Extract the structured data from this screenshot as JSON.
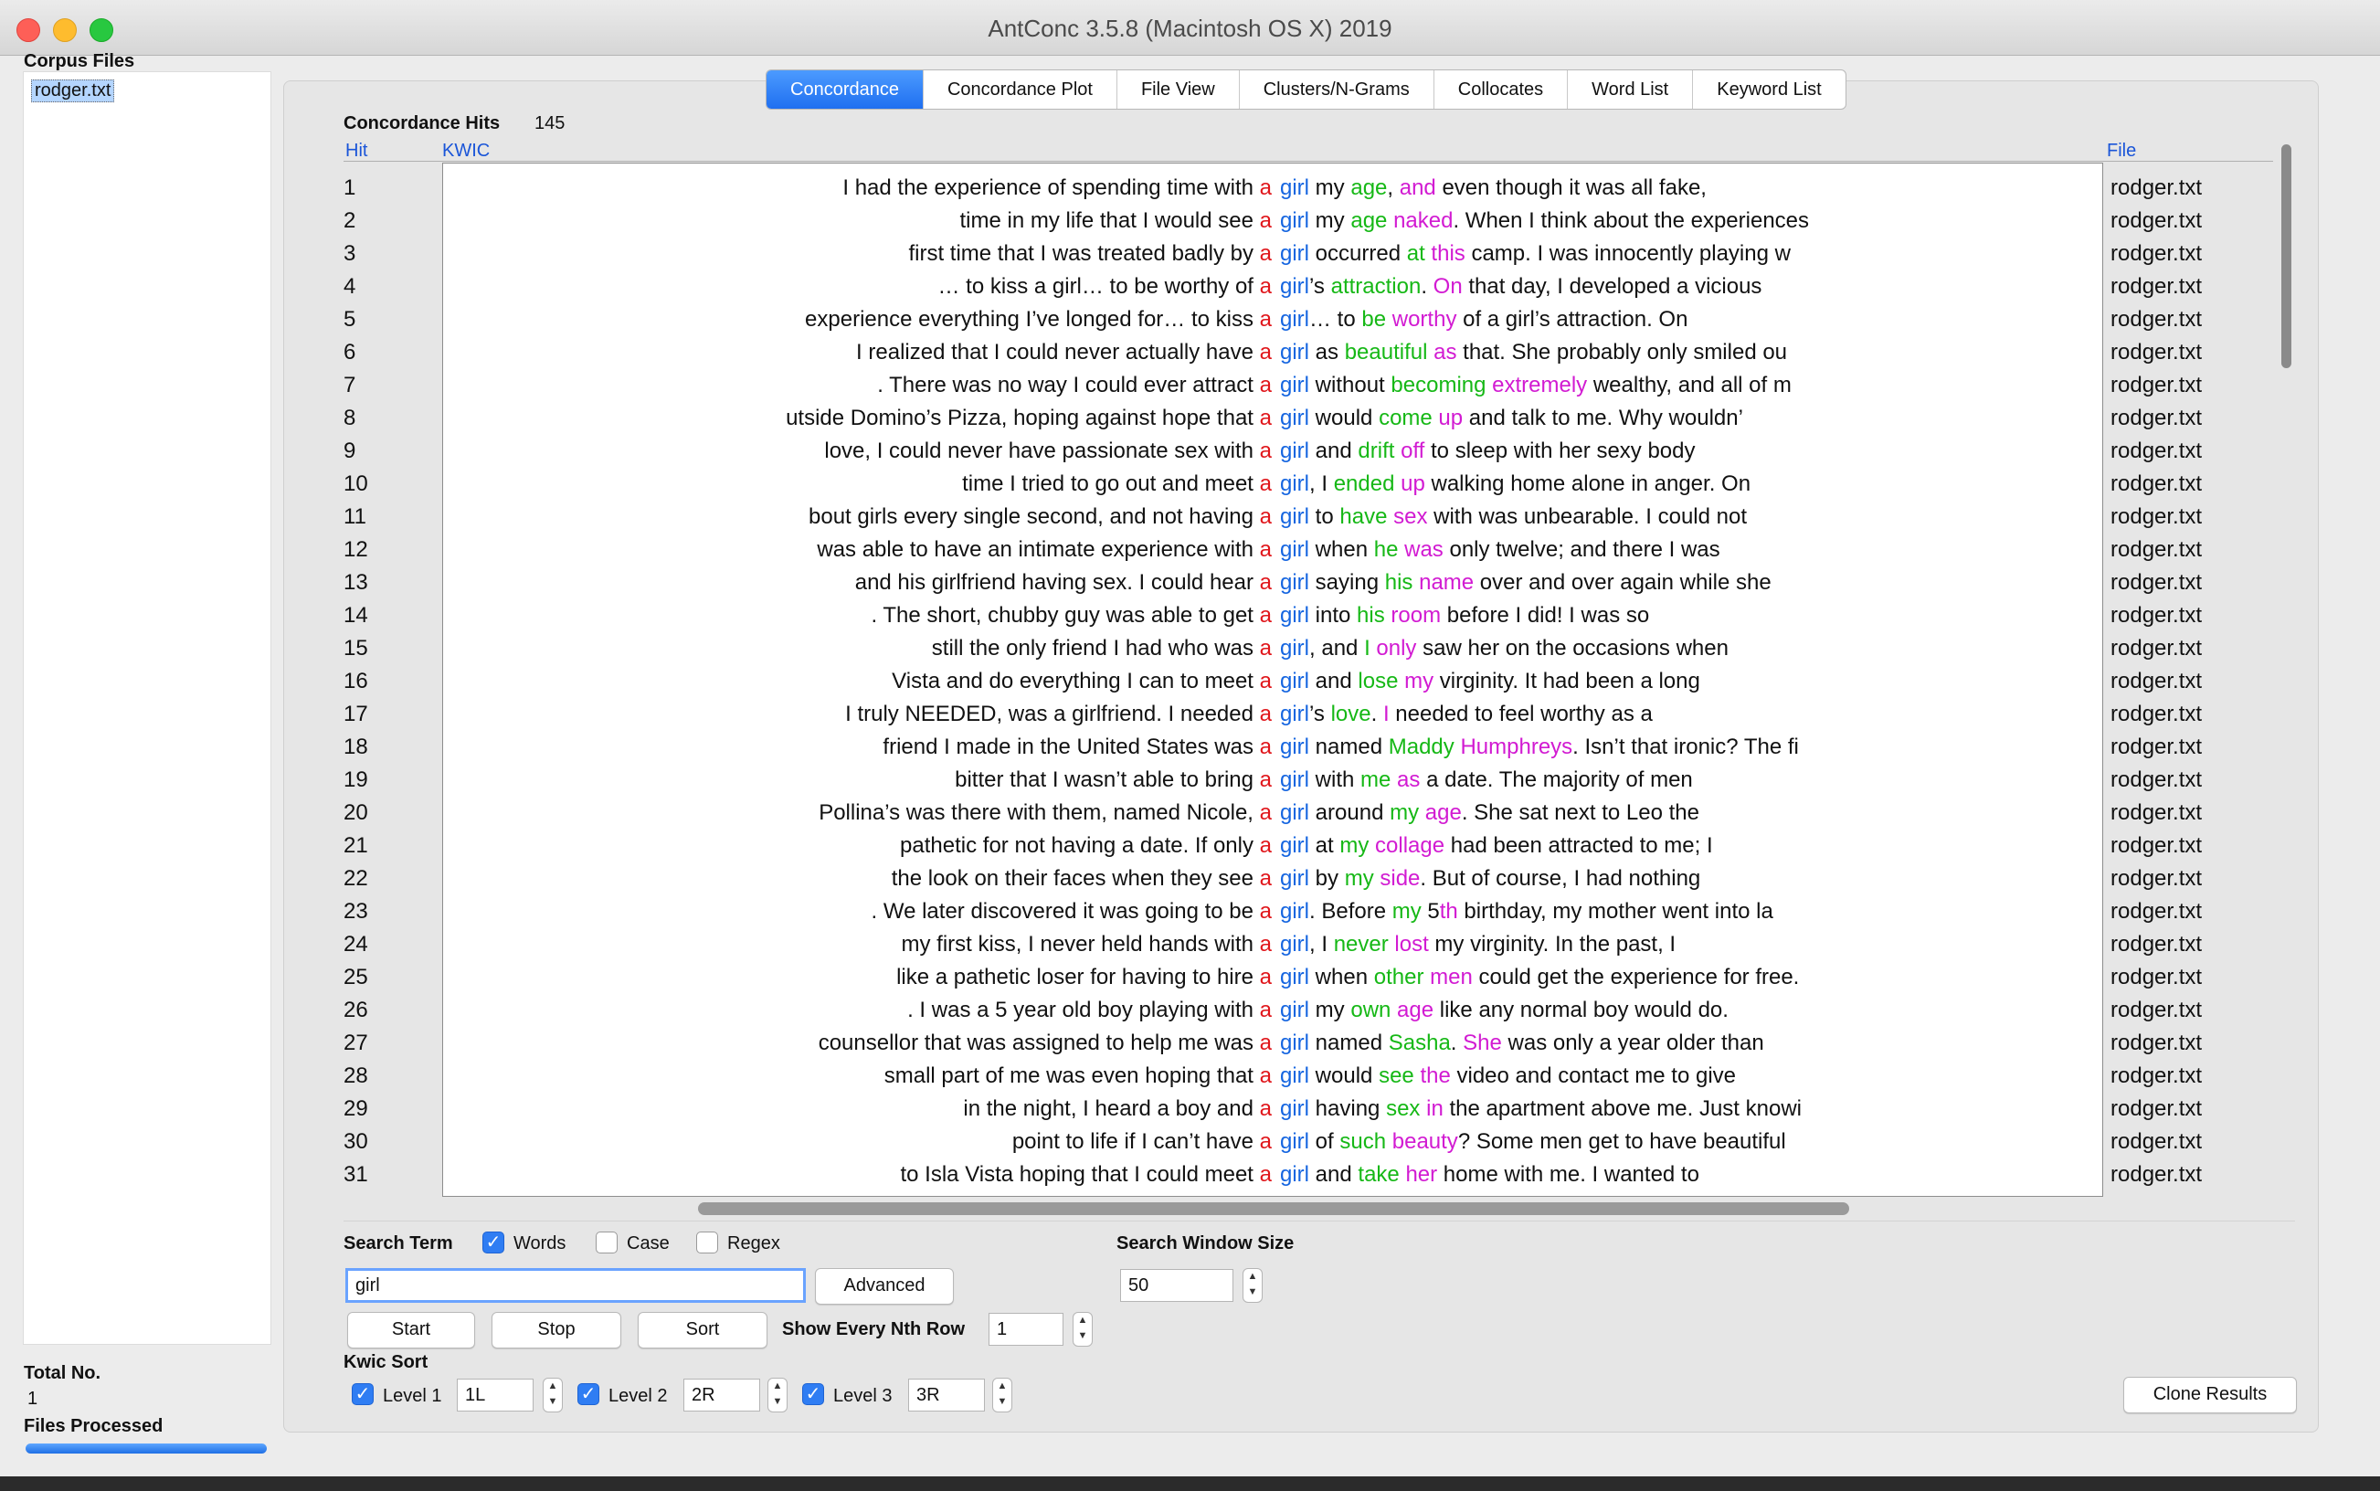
{
  "window": {
    "title": "AntConc 3.5.8 (Macintosh OS X) 2019"
  },
  "sidebar": {
    "corpus_files_label": "Corpus Files",
    "files": [
      "rodger.txt"
    ],
    "total_no_label": "Total No.",
    "total_no_value": "1",
    "files_processed_label": "Files Processed",
    "progress": 1.0
  },
  "tabs": [
    "Concordance",
    "Concordance Plot",
    "File View",
    "Clusters/N-Grams",
    "Collocates",
    "Word List",
    "Keyword List"
  ],
  "active_tab": "Concordance",
  "results": {
    "hits_label": "Concordance Hits",
    "hits_count": "145",
    "col_hit": "Hit",
    "col_kwic": "KWIC",
    "col_file": "File",
    "rows": [
      {
        "hit": "1",
        "left": "I had the experience of spending time with",
        "key": "girl",
        "right": [
          [
            "my ",
            ""
          ],
          [
            "age",
            ""
          ],
          [
            ", ",
            ""
          ],
          [
            "and",
            ""
          ],
          [
            "  even though it was all fake,",
            ""
          ]
        ],
        "file": "rodger.txt"
      },
      {
        "hit": "2",
        "left": "time in my life that I would see",
        "key": "girl",
        "right": [
          [
            "my ",
            ""
          ],
          [
            "age",
            ""
          ],
          [
            " ",
            ""
          ],
          [
            "naked",
            ""
          ],
          [
            ". When  I think about the experiences",
            ""
          ]
        ],
        "file": "rodger.txt"
      },
      {
        "hit": "3",
        "left": "first time that I was treated badly  by",
        "key": "girl",
        "right": [
          [
            "occurred ",
            ""
          ],
          [
            "at",
            ""
          ],
          [
            " ",
            ""
          ],
          [
            "this",
            ""
          ],
          [
            " camp. I was innocently playing w",
            ""
          ]
        ],
        "file": "rodger.txt"
      },
      {
        "hit": "4",
        "left": "… to kiss a girl… to be worthy of",
        "key": "girl",
        "right": [
          [
            "’s ",
            ""
          ],
          [
            "attraction",
            ""
          ],
          [
            ". ",
            ""
          ],
          [
            "On",
            ""
          ],
          [
            " that day, I developed a vicious",
            ""
          ]
        ],
        "file": "rodger.txt"
      },
      {
        "hit": "5",
        "left": "experience everything I’ve longed for… to kiss",
        "key": "girl",
        "right": [
          [
            "… to ",
            ""
          ],
          [
            "be",
            ""
          ],
          [
            " ",
            ""
          ],
          [
            "worthy",
            ""
          ],
          [
            " of a  girl’s attraction. On",
            ""
          ]
        ],
        "file": "rodger.txt"
      },
      {
        "hit": "6",
        "left": "I  realized that I could never actually have",
        "key": "girl",
        "right": [
          [
            "as ",
            ""
          ],
          [
            "beautiful",
            ""
          ],
          [
            " ",
            ""
          ],
          [
            "as",
            ""
          ],
          [
            " that. She probably only smiled ou",
            ""
          ]
        ],
        "file": "rodger.txt"
      },
      {
        "hit": "7",
        "left": ". There was no way I could ever attract",
        "key": "girl",
        "right": [
          [
            "without  ",
            ""
          ],
          [
            "becoming",
            ""
          ],
          [
            " ",
            ""
          ],
          [
            "extremely",
            ""
          ],
          [
            " wealthy, and all of m",
            ""
          ]
        ],
        "file": "rodger.txt"
      },
      {
        "hit": "8",
        "left": "utside Domino’s Pizza, hoping against hope that",
        "key": "girl",
        "right": [
          [
            "would ",
            ""
          ],
          [
            "come",
            ""
          ],
          [
            " ",
            ""
          ],
          [
            "up",
            ""
          ],
          [
            "  and talk to me. Why wouldn’",
            ""
          ]
        ],
        "file": "rodger.txt"
      },
      {
        "hit": "9",
        "left": "love, I could never have passionate sex with",
        "key": "girl",
        "right": [
          [
            " and ",
            ""
          ],
          [
            "drift",
            ""
          ],
          [
            " ",
            ""
          ],
          [
            "off",
            ""
          ],
          [
            " to sleep with her sexy body",
            ""
          ]
        ],
        "file": "rodger.txt"
      },
      {
        "hit": "10",
        "left": "time I tried to go out and meet",
        "key": "girl",
        "right": [
          [
            ", I ",
            ""
          ],
          [
            "ended",
            ""
          ],
          [
            " ",
            ""
          ],
          [
            "up",
            ""
          ],
          [
            "  walking home alone in anger. On",
            ""
          ]
        ],
        "file": "rodger.txt"
      },
      {
        "hit": "11",
        "left": "bout girls  every single second, and not having",
        "key": "girl",
        "right": [
          [
            "to ",
            ""
          ],
          [
            "have",
            ""
          ],
          [
            " ",
            ""
          ],
          [
            "sex",
            ""
          ],
          [
            " with was unbearable. I could not",
            ""
          ]
        ],
        "file": "rodger.txt"
      },
      {
        "hit": "12",
        "left": "was able to have an intimate experience with",
        "key": "girl",
        "right": [
          [
            "when ",
            ""
          ],
          [
            "he",
            ""
          ],
          [
            " ",
            ""
          ],
          [
            "was",
            ""
          ],
          [
            "  only twelve; and there I was",
            ""
          ]
        ],
        "file": "rodger.txt"
      },
      {
        "hit": "13",
        "left": "and his girlfriend  having sex. I could hear",
        "key": "girl",
        "right": [
          [
            "saying ",
            ""
          ],
          [
            "his",
            ""
          ],
          [
            " ",
            ""
          ],
          [
            "name",
            ""
          ],
          [
            " over and over again while she",
            ""
          ]
        ],
        "file": "rodger.txt"
      },
      {
        "hit": "14",
        "left": ". The short, chubby guy was able to get",
        "key": "girl",
        "right": [
          [
            "into ",
            ""
          ],
          [
            "his",
            ""
          ],
          [
            " ",
            ""
          ],
          [
            "room",
            ""
          ],
          [
            " before I  did! I was so",
            ""
          ]
        ],
        "file": "rodger.txt"
      },
      {
        "hit": "15",
        "left": "still the only friend I had who was",
        "key": "girl",
        "right": [
          [
            ", and ",
            ""
          ],
          [
            "I",
            ""
          ],
          [
            " ",
            ""
          ],
          [
            "only",
            ""
          ],
          [
            " saw her on the occasions when",
            ""
          ]
        ],
        "file": "rodger.txt"
      },
      {
        "hit": "16",
        "left": "Vista  and do everything I can to meet",
        "key": "girl",
        "right": [
          [
            "and ",
            ""
          ],
          [
            "lose",
            ""
          ],
          [
            " ",
            ""
          ],
          [
            "my",
            ""
          ],
          [
            " virginity. It had been a long",
            ""
          ]
        ],
        "file": "rodger.txt"
      },
      {
        "hit": "17",
        "left": "I truly NEEDED, was a girlfriend. I needed",
        "key": "girl",
        "right": [
          [
            "’s ",
            ""
          ],
          [
            "love",
            ""
          ],
          [
            ". ",
            ""
          ],
          [
            "I",
            ""
          ],
          [
            "  needed to feel worthy as a",
            ""
          ]
        ],
        "file": "rodger.txt"
      },
      {
        "hit": "18",
        "left": "friend I made in the United States was",
        "key": "girl",
        "right": [
          [
            "named ",
            ""
          ],
          [
            "Maddy",
            ""
          ],
          [
            " ",
            ""
          ],
          [
            "Humphreys",
            ""
          ],
          [
            ". Isn’t that ironic?  The fi",
            ""
          ]
        ],
        "file": "rodger.txt"
      },
      {
        "hit": "19",
        "left": "bitter that I wasn’t able to bring",
        "key": "girl",
        "right": [
          [
            "with ",
            ""
          ],
          [
            "me",
            ""
          ],
          [
            " ",
            ""
          ],
          [
            "as",
            ""
          ],
          [
            " a  date. The majority of men",
            ""
          ]
        ],
        "file": "rodger.txt"
      },
      {
        "hit": "20",
        "left": "Pollina’s was there with them,  named Nicole,",
        "key": "girl",
        "right": [
          [
            "around ",
            ""
          ],
          [
            "my",
            ""
          ],
          [
            " ",
            ""
          ],
          [
            "age",
            ""
          ],
          [
            ". She sat next to Leo the",
            ""
          ]
        ],
        "file": "rodger.txt"
      },
      {
        "hit": "21",
        "left": "pathetic for not having a date.  If only",
        "key": "girl",
        "right": [
          [
            "at ",
            ""
          ],
          [
            "my",
            ""
          ],
          [
            " ",
            ""
          ],
          [
            "collage",
            ""
          ],
          [
            " had been attracted to me; I",
            ""
          ]
        ],
        "file": "rodger.txt"
      },
      {
        "hit": "22",
        "left": "the look on their faces when they see",
        "key": "girl",
        "right": [
          [
            "by ",
            ""
          ],
          [
            "my",
            ""
          ],
          [
            " ",
            ""
          ],
          [
            "side",
            ""
          ],
          [
            ". But of course, I had  nothing",
            ""
          ]
        ],
        "file": "rodger.txt"
      },
      {
        "hit": "23",
        "left": ". We later discovered it was going to be",
        "key": "girl",
        "right": [
          [
            ".   Before ",
            ""
          ],
          [
            "my",
            ""
          ],
          [
            " 5",
            ""
          ],
          [
            "th",
            ""
          ],
          [
            " birthday, my mother went into la",
            ""
          ]
        ],
        "file": "rodger.txt"
      },
      {
        "hit": "24",
        "left": "my first kiss, I never held hands with",
        "key": "girl",
        "right": [
          [
            ", I ",
            ""
          ],
          [
            "never",
            ""
          ],
          [
            " ",
            ""
          ],
          [
            "lost",
            ""
          ],
          [
            " my virginity. In the past, I",
            ""
          ]
        ],
        "file": "rodger.txt"
      },
      {
        "hit": "25",
        "left": "like a pathetic loser for having to hire",
        "key": "girl",
        "right": [
          [
            "when ",
            ""
          ],
          [
            "other",
            ""
          ],
          [
            " ",
            ""
          ],
          [
            "men",
            ""
          ],
          [
            " could get the experience for free.",
            ""
          ]
        ],
        "file": "rodger.txt"
      },
      {
        "hit": "26",
        "left": ".   I was a 5 year old boy playing with",
        "key": "girl",
        "right": [
          [
            "my ",
            ""
          ],
          [
            "own",
            ""
          ],
          [
            " ",
            ""
          ],
          [
            "age",
            ""
          ],
          [
            " like any normal boy would do.",
            ""
          ]
        ],
        "file": "rodger.txt"
      },
      {
        "hit": "27",
        "left": "counsellor that was assigned to help me was",
        "key": "girl",
        "right": [
          [
            "named ",
            ""
          ],
          [
            "Sasha",
            ""
          ],
          [
            ". ",
            ""
          ],
          [
            "She",
            ""
          ],
          [
            " was only a year  older than",
            ""
          ]
        ],
        "file": "rodger.txt"
      },
      {
        "hit": "28",
        "left": "small  part of me was even hoping that",
        "key": "girl",
        "right": [
          [
            "would ",
            ""
          ],
          [
            "see",
            ""
          ],
          [
            " ",
            ""
          ],
          [
            "the",
            ""
          ],
          [
            " video and contact me to give",
            ""
          ]
        ],
        "file": "rodger.txt"
      },
      {
        "hit": "29",
        "left": "in the night, I heard a boy and",
        "key": "girl",
        "right": [
          [
            "having ",
            ""
          ],
          [
            "sex",
            ""
          ],
          [
            " ",
            ""
          ],
          [
            "in",
            ""
          ],
          [
            " the apartment above me. Just  knowi",
            ""
          ]
        ],
        "file": "rodger.txt"
      },
      {
        "hit": "30",
        "left": "point to life if I can’t have",
        "key": "girl",
        "right": [
          [
            "of ",
            ""
          ],
          [
            "such",
            ""
          ],
          [
            " ",
            ""
          ],
          [
            "beauty",
            ""
          ],
          [
            "?  Some men get to have beautiful",
            ""
          ]
        ],
        "file": "rodger.txt"
      },
      {
        "hit": "31",
        "left": "to Isla Vista hoping that I could meet",
        "key": "girl",
        "right": [
          [
            "and ",
            ""
          ],
          [
            "take",
            ""
          ],
          [
            " ",
            ""
          ],
          [
            "her",
            ""
          ],
          [
            " home with me. I wanted to",
            ""
          ]
        ],
        "file": "rodger.txt"
      }
    ],
    "left_key_word": "a"
  },
  "colors": {
    "l1": "#e0161b",
    "r1": "#16b816",
    "r2": "#d21bd2",
    "key": "#1565e0"
  },
  "search": {
    "search_term_label": "Search Term",
    "words_label": "Words",
    "words_checked": true,
    "case_label": "Case",
    "case_checked": false,
    "regex_label": "Regex",
    "regex_checked": false,
    "term_value": "girl",
    "advanced_label": "Advanced",
    "window_size_label": "Search Window Size",
    "window_size_value": "50",
    "start_label": "Start",
    "stop_label": "Stop",
    "sort_label": "Sort",
    "nth_row_label": "Show Every Nth Row",
    "nth_row_value": "1"
  },
  "kwic_sort": {
    "label": "Kwic Sort",
    "level1_label": "Level 1",
    "level1_value": "1L",
    "level2_label": "Level 2",
    "level2_value": "2R",
    "level3_label": "Level 3",
    "level3_value": "3R",
    "clone_label": "Clone Results"
  }
}
